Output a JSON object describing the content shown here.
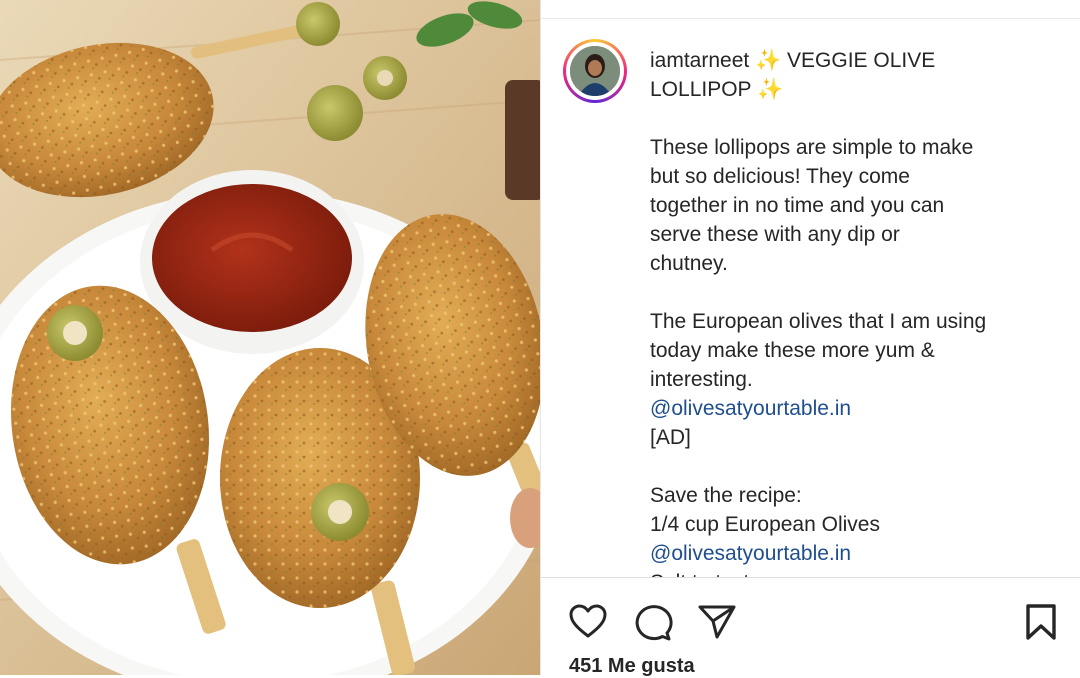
{
  "post": {
    "username": "iamtarneet",
    "title_part1": "✨ VEGGIE OLIVE",
    "title_part2": "LOLLIPOP ✨",
    "intro_lines": [
      "These lollipops are simple to make",
      "but so delicious! They come",
      "together in no time and you can",
      "serve these with any dip or",
      "chutney."
    ],
    "olives_lines": [
      "The European olives that I am using",
      "today make these more yum &",
      "interesting."
    ],
    "mention": "@olivesatyourtable.in",
    "ad_tag": "[AD]",
    "recipe_heading": "Save the recipe:",
    "recipe_item_1": "1/4 cup European Olives",
    "recipe_mention": "@olivesatyourtable.in",
    "recipe_cut_line": "Salt to taste"
  },
  "actions": {
    "like_icon": "heart-icon",
    "comment_icon": "comment-icon",
    "share_icon": "paper-plane-icon",
    "save_icon": "bookmark-icon"
  },
  "likes_text": "451 Me gusta",
  "colors": {
    "mention": "#1f4e8f",
    "text": "#262626",
    "ring_start": "#f9ce34",
    "ring_mid": "#ee2a7b"
  }
}
